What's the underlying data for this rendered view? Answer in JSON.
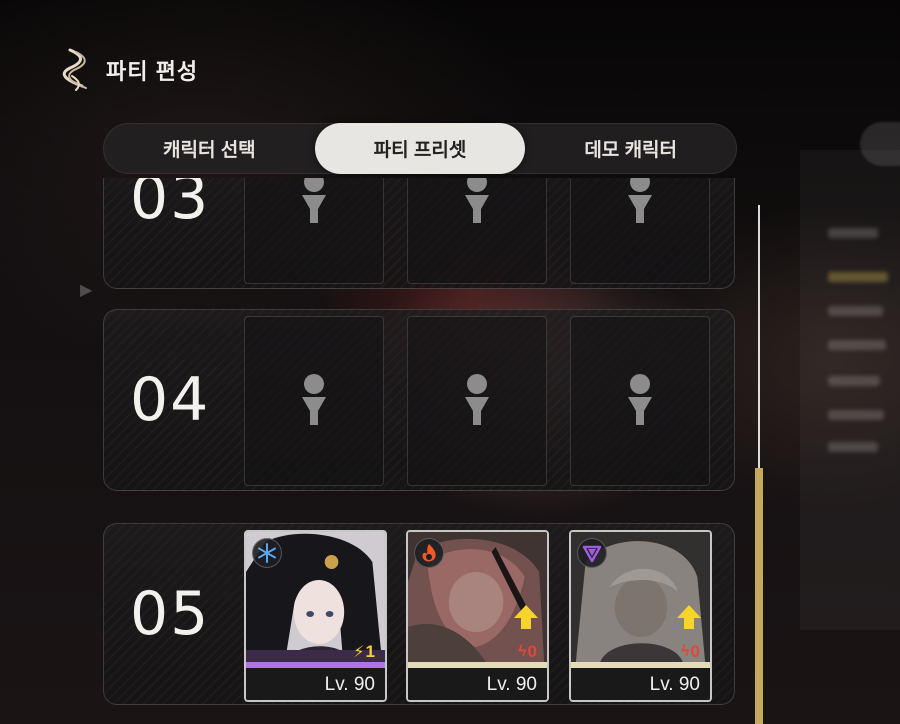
{
  "header": {
    "title": "파티 편성",
    "logo_icon": "helix-logo-icon"
  },
  "tabs": [
    {
      "label": "캐릭터 선택",
      "active": false
    },
    {
      "label": "파티 프리셋",
      "active": true
    },
    {
      "label": "데모 캐릭터",
      "active": false
    }
  ],
  "presets": [
    {
      "number": "03",
      "slots": [
        "empty",
        "empty",
        "empty"
      ]
    },
    {
      "number": "04",
      "slots": [
        "empty",
        "empty",
        "empty"
      ]
    },
    {
      "number": "05",
      "characters": [
        {
          "element": "ice",
          "element_icon": "snowflake-icon",
          "element_color": "#3a8fe0",
          "energy": "1",
          "energy_color": "#f5cf3a",
          "level": "Lv. 90",
          "bar_color": "#b074e6",
          "upgrade": false
        },
        {
          "element": "fire",
          "element_icon": "flame-icon",
          "element_color": "#f05a28",
          "energy": "0",
          "energy_color": "#e0463c",
          "level": "Lv. 90",
          "bar_color": "#e4dcb6",
          "upgrade": true
        },
        {
          "element": "void",
          "element_icon": "crystal-icon",
          "element_color": "#a05be0",
          "energy": "0",
          "energy_color": "#e0463c",
          "level": "Lv. 90",
          "bar_color": "#e4dcb6",
          "upgrade": true
        }
      ]
    }
  ],
  "colors": {
    "accent_gold": "#c6a95a",
    "tab_active_bg": "#e8e6e3",
    "upgrade_yellow": "#f6d42b"
  }
}
